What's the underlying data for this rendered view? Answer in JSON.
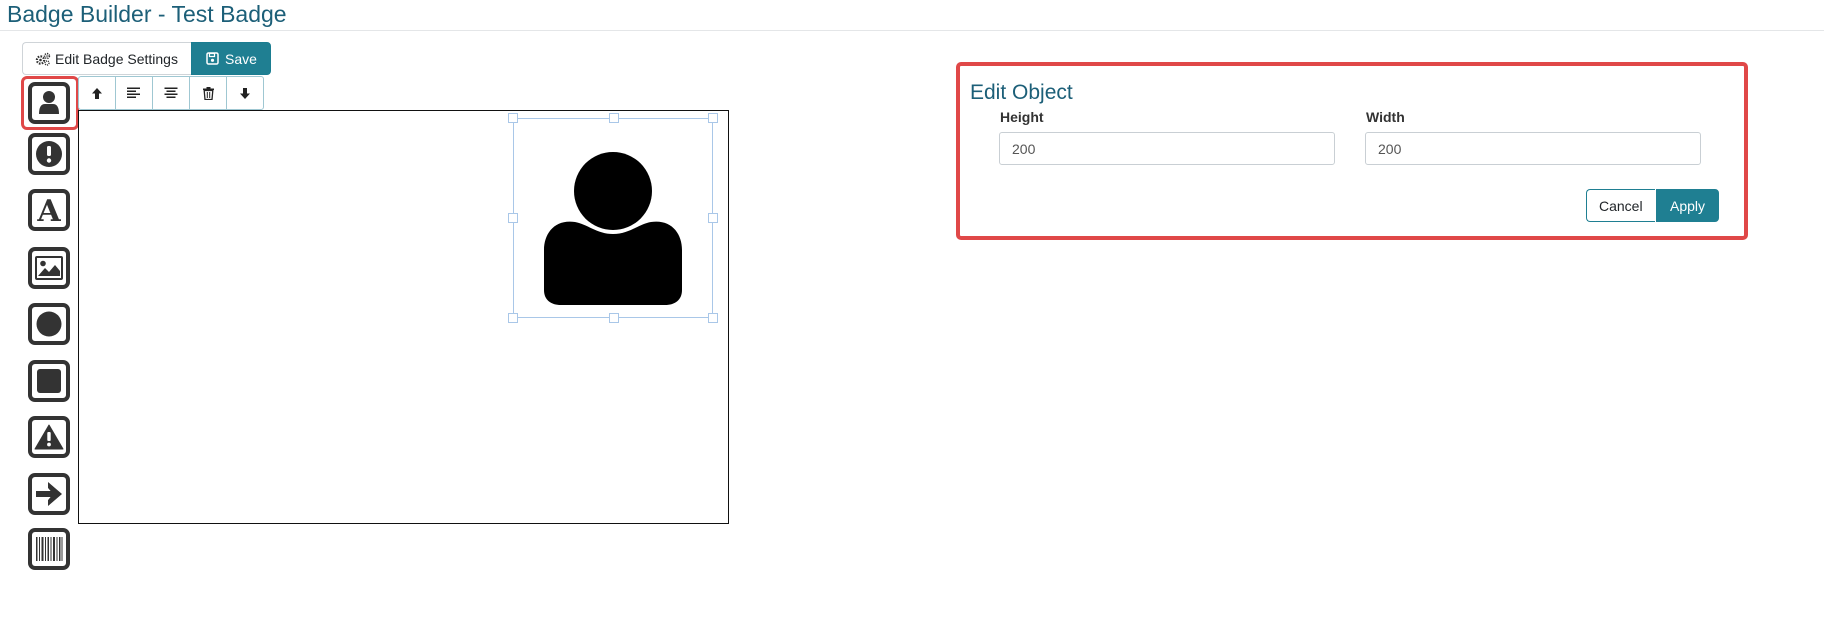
{
  "page": {
    "title": "Badge Builder - Test Badge"
  },
  "toolbar": {
    "settings_label": "Edit Badge Settings",
    "settings_icon": "gears-icon",
    "save_label": "Save",
    "save_icon": "floppy-disk-icon"
  },
  "palette": {
    "items": [
      {
        "name": "user-photo",
        "icon": "user-icon",
        "selected": true
      },
      {
        "name": "alert",
        "icon": "exclamation-circle-icon",
        "selected": false
      },
      {
        "name": "text",
        "icon": "letter-a-icon",
        "selected": false
      },
      {
        "name": "image",
        "icon": "image-icon",
        "selected": false
      },
      {
        "name": "circle",
        "icon": "circle-icon",
        "selected": false
      },
      {
        "name": "square",
        "icon": "square-icon",
        "selected": false
      },
      {
        "name": "warning",
        "icon": "warning-triangle-icon",
        "selected": false
      },
      {
        "name": "arrow",
        "icon": "arrow-right-icon",
        "selected": false
      },
      {
        "name": "barcode",
        "icon": "barcode-icon",
        "selected": false
      }
    ]
  },
  "edit_toolbar": {
    "buttons": [
      {
        "name": "bring-forward",
        "icon": "arrow-up-icon"
      },
      {
        "name": "align-left",
        "icon": "align-left-icon"
      },
      {
        "name": "align-center",
        "icon": "align-center-icon"
      },
      {
        "name": "delete",
        "icon": "trash-icon"
      },
      {
        "name": "send-backward",
        "icon": "arrow-down-icon"
      }
    ]
  },
  "canvas": {
    "selected_object": "user-icon"
  },
  "edit_object": {
    "title": "Edit Object",
    "height_label": "Height",
    "height_value": "200",
    "width_label": "Width",
    "width_value": "200",
    "cancel_label": "Cancel",
    "apply_label": "Apply"
  },
  "colors": {
    "accent": "#1f7f92",
    "title": "#1c5f78",
    "highlight": "#e04848"
  }
}
